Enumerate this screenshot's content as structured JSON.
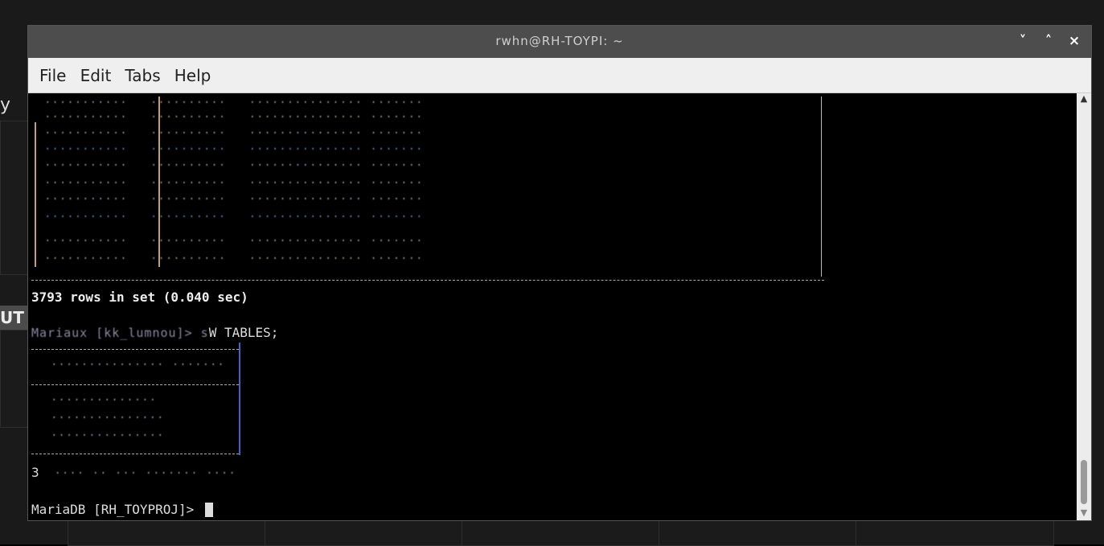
{
  "window": {
    "title": "rwhn@RH-TOYPI: ~",
    "controls": [
      "˅",
      "˄",
      "×"
    ]
  },
  "menubar": {
    "items": [
      "File",
      "Edit",
      "Tabs",
      "Help"
    ]
  },
  "background": {
    "left_text_1": "y",
    "left_text_2": "UT"
  },
  "terminal": {
    "result_summary_1": "3793 rows in set (0.040 sec)",
    "command_prompt_1": "MariaDB [RH_TOYPROJ]> ",
    "command_text_1": "SHOW TABLES;",
    "visible_command_fragment": "W TABLES;",
    "result_summary_2_prefix": "3",
    "prompt_final": "MariaDB [RH_TOYPROJ]> "
  }
}
